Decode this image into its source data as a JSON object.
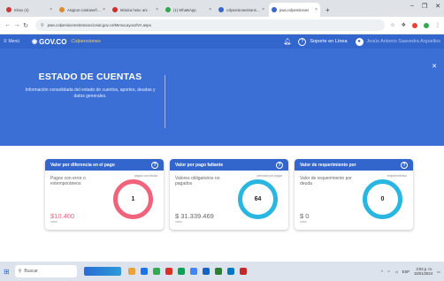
{
  "browser": {
    "tabs": [
      {
        "title": "Inbox (4)",
        "fav": "#c83a3a",
        "active": false
      },
      {
        "title": "Asignar contraseña ·",
        "fav": "#e08a2e",
        "active": false
      },
      {
        "title": "Música heta: ani ·",
        "fav": "#d42b2b",
        "active": false
      },
      {
        "title": "(1) WhatsApp",
        "fav": "#2fa84a",
        "active": false
      },
      {
        "title": "colpensionestransac",
        "fav": "#3a68c8",
        "active": false
      },
      {
        "title": "pwa.colpensiones",
        "fav": "#3a68c8",
        "active": true
      }
    ],
    "url": "pwa.colpensionestransaccional.gov.co/MenuLayout/VA.aspx",
    "icons": {
      "back": "back-arrow-icon",
      "forward": "forward-arrow-icon",
      "reload": "reload-icon",
      "lock": "lock-icon"
    }
  },
  "header": {
    "menu_label": "Menú",
    "brand": "GOV.CO",
    "logo_text": "Colpensiones",
    "support_label": "Soporte en Línea",
    "user_name": "Jesús Antonio Saavedra Arguelles",
    "colors": {
      "header": "#3366cc",
      "banner": "#3b6fd6"
    }
  },
  "banner": {
    "title": "ESTADO DE CUENTAS",
    "description": "Información consolidada del estado de cuentos, aportes, deudas y datos generales."
  },
  "cards": [
    {
      "title": "Valor por diferencia en el pago",
      "label": "Pagos con error o extemporáneos",
      "pill": "pagos con deuda",
      "amount": "$10.400",
      "sub": "valor",
      "count": "1",
      "ring_color": "#f0637a",
      "amount_color": "#f0637a"
    },
    {
      "title": "Valor por pago faltante",
      "label": "Valores obligatorios no pagados",
      "pill": "periodos por pagar",
      "amount": "$ 31.339.469",
      "sub": "valor",
      "count": "64",
      "ring_color": "#29b6e0",
      "amount_color": "#666666"
    },
    {
      "title": "Valor de requerimiento por",
      "label": "Valor de requerimiento por deuda",
      "pill": "requerimientos",
      "amount": "$ 0",
      "sub": "valor",
      "count": "0",
      "ring_color": "#29b6e0",
      "amount_color": "#666666"
    }
  ],
  "taskbar": {
    "search_label": "Buscar",
    "time": "3:03 p. m.",
    "date": "15/01/2024",
    "lang": "ESP"
  }
}
